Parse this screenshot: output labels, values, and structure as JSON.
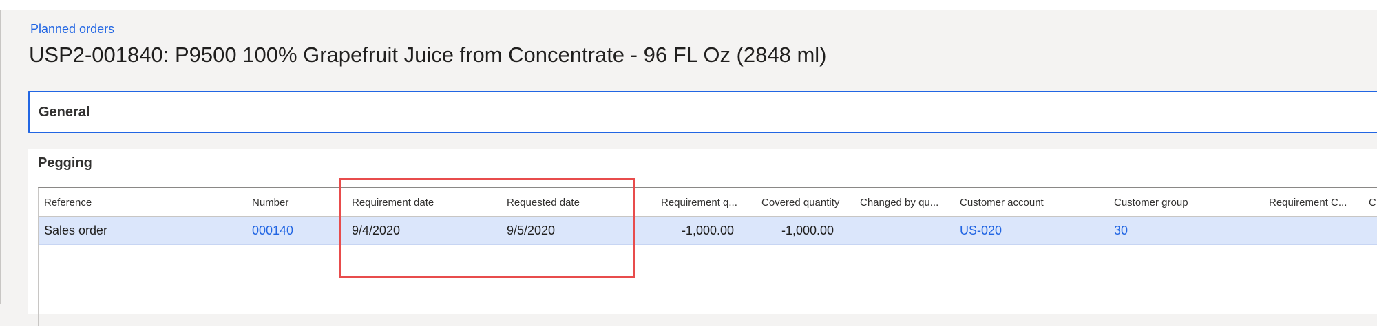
{
  "breadcrumb": "Planned orders",
  "page_title": "USP2-001840: P9500 100% Grapefruit Juice from Concentrate - 96 FL Oz (2848 ml)",
  "sections": {
    "general": "General",
    "pegging": "Pegging"
  },
  "grid": {
    "columns": [
      "Reference",
      "Number",
      "Requirement date",
      "Requested date",
      "Requirement q...",
      "Covered quantity",
      "Changed by qu...",
      "Customer account",
      "Customer group",
      "Requirement C...",
      "C"
    ],
    "rows": [
      {
        "reference": "Sales order",
        "number": "000140",
        "requirement_date": "9/4/2020",
        "requested_date": "9/5/2020",
        "requirement_qty": "-1,000.00",
        "covered_quantity": "-1,000.00",
        "changed_by_qty": "",
        "customer_account": "US-020",
        "customer_group": "30",
        "requirement_c": ""
      }
    ]
  },
  "colors": {
    "link": "#2266e3",
    "selected_row": "#dbe6fb",
    "highlight": "#e84c4c",
    "focus_border": "#2266e3"
  }
}
